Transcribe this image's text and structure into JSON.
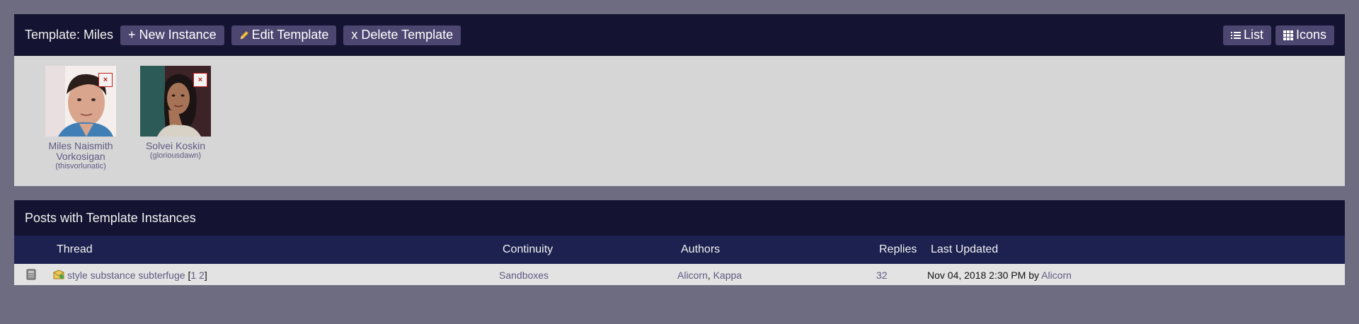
{
  "template": {
    "title": "Template: Miles",
    "buttons": {
      "new_instance": "+ New Instance",
      "edit": "Edit Template",
      "delete": "x Delete Template",
      "list": "List",
      "icons": "Icons"
    },
    "instances": [
      {
        "name": "Miles Naismith Vorkosigan",
        "screen_name": "(thisvorlunatic)",
        "delete_label": "×"
      },
      {
        "name": "Solvei Koskin",
        "screen_name": "(gloriousdawn)",
        "delete_label": "×"
      }
    ]
  },
  "posts": {
    "title": "Posts with Template Instances",
    "columns": {
      "thread": "Thread",
      "continuity": "Continuity",
      "authors": "Authors",
      "replies": "Replies",
      "last_updated": "Last Updated"
    },
    "rows": [
      {
        "thread": "style substance subterfuge",
        "page_open": "[",
        "page1": "1",
        "page2": "2",
        "page_close": "]",
        "continuity": "Sandboxes",
        "author1": "Alicorn",
        "author_sep": ",",
        "author2": "Kappa",
        "replies": "32",
        "last_updated": "Nov 04, 2018 2:30 PM",
        "by": "by",
        "last_author": "Alicorn"
      }
    ]
  },
  "colors": {
    "page_bg": "#6e6c80",
    "header_bg": "#141432",
    "table_header_bg": "#1c214f",
    "button_bg": "#4d4670",
    "link": "#5f5a82"
  }
}
